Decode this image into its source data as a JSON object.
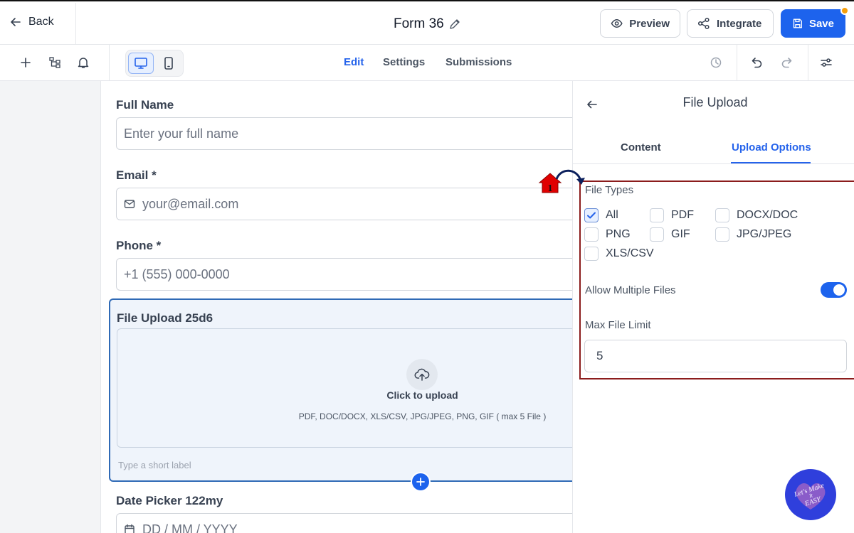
{
  "header": {
    "back_label": "Back",
    "form_title": "Form 36",
    "preview_label": "Preview",
    "integrate_label": "Integrate",
    "save_label": "Save"
  },
  "toolbar": {
    "tabs": [
      {
        "label": "Edit",
        "active": true
      },
      {
        "label": "Settings",
        "active": false
      },
      {
        "label": "Submissions",
        "active": false
      }
    ],
    "active_device": "desktop"
  },
  "form": {
    "fields": [
      {
        "label": "Full Name",
        "placeholder": "Enter your full name"
      },
      {
        "label": "Email *",
        "placeholder": "your@email.com",
        "icon": "mail-icon"
      },
      {
        "label": "Phone *",
        "placeholder": "+1 (555) 000-0000"
      }
    ],
    "upload": {
      "title": "File Upload 25d6",
      "cta": "Click to upload",
      "hint": "PDF, DOC/DOCX, XLS/CSV, JPG/JPEG, PNG, GIF ( max 5 File )",
      "short_label_placeholder": "Type a short label"
    },
    "date_picker": {
      "label": "Date Picker 122my",
      "placeholder": "DD / MM / YYYY"
    }
  },
  "panel": {
    "title": "File Upload",
    "tabs": [
      {
        "label": "Content",
        "active": false
      },
      {
        "label": "Upload Options",
        "active": true
      }
    ],
    "file_types_label": "File Types",
    "file_types": [
      {
        "label": "All",
        "checked": true
      },
      {
        "label": "PDF",
        "checked": false
      },
      {
        "label": "DOCX/DOC",
        "checked": false
      },
      {
        "label": "PNG",
        "checked": false
      },
      {
        "label": "GIF",
        "checked": false
      },
      {
        "label": "JPG/JPEG",
        "checked": false
      },
      {
        "label": "XLS/CSV",
        "checked": false
      }
    ],
    "allow_multiple_label": "Allow Multiple Files",
    "allow_multiple": true,
    "max_file_limit_label": "Max File Limit",
    "max_file_limit": "5"
  },
  "annotation": {
    "marker_number": "1"
  },
  "watermark": {
    "text": "Let's Make It EASY"
  },
  "colors": {
    "accent": "#1d63ed",
    "highlight_border": "#8b1c1c",
    "badge": "#f59e0b",
    "marker_red": "#e00000"
  }
}
